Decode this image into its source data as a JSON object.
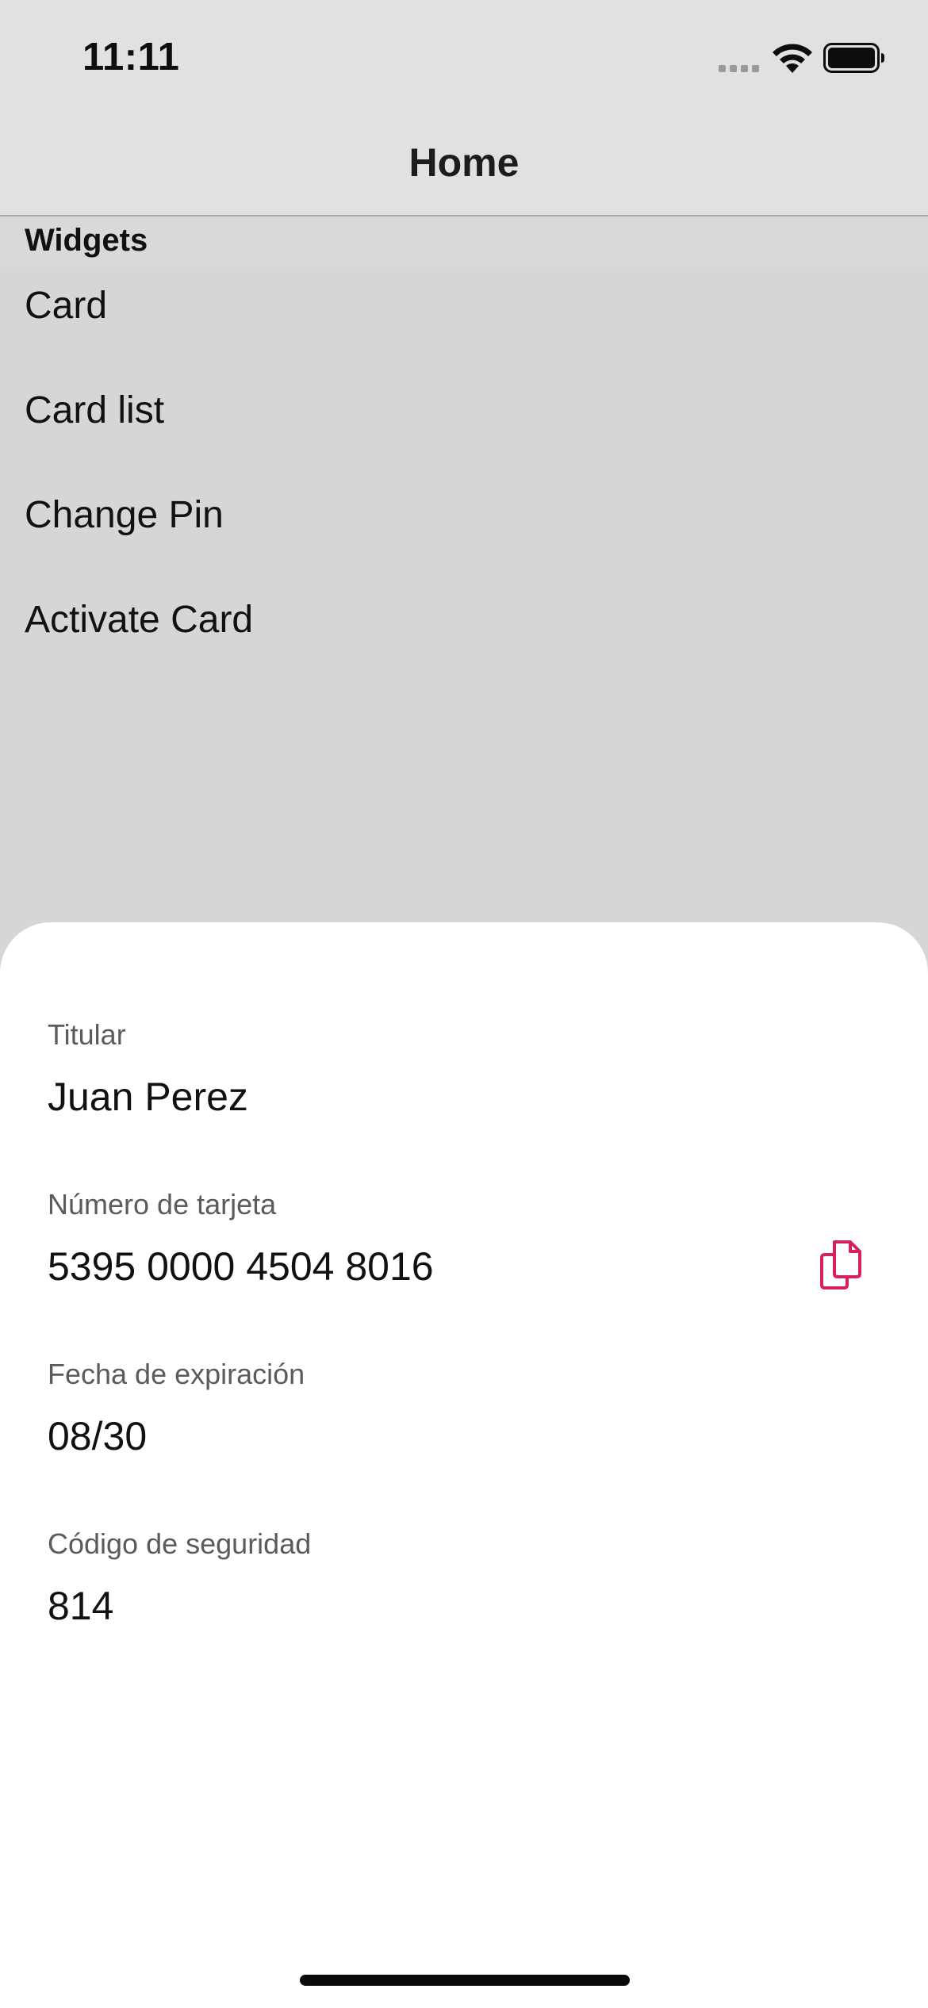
{
  "status_bar": {
    "time": "11:11"
  },
  "nav": {
    "title": "Home"
  },
  "list": {
    "section_header": "Widgets",
    "items": [
      {
        "label": "Card"
      },
      {
        "label": "Card list"
      },
      {
        "label": "Change Pin"
      },
      {
        "label": "Activate Card"
      }
    ]
  },
  "sheet": {
    "fields": [
      {
        "label": "Titular",
        "value": "Juan Perez"
      },
      {
        "label": "Número de tarjeta",
        "value": "5395 0000 4504 8016"
      },
      {
        "label": "Fecha de expiración",
        "value": "08/30"
      },
      {
        "label": "Código de seguridad",
        "value": "814"
      }
    ],
    "copy_icon": "copy-icon"
  },
  "colors": {
    "accent": "#d6215f",
    "scrim": "#d6d6d6",
    "sheet_background": "#ffffff"
  }
}
